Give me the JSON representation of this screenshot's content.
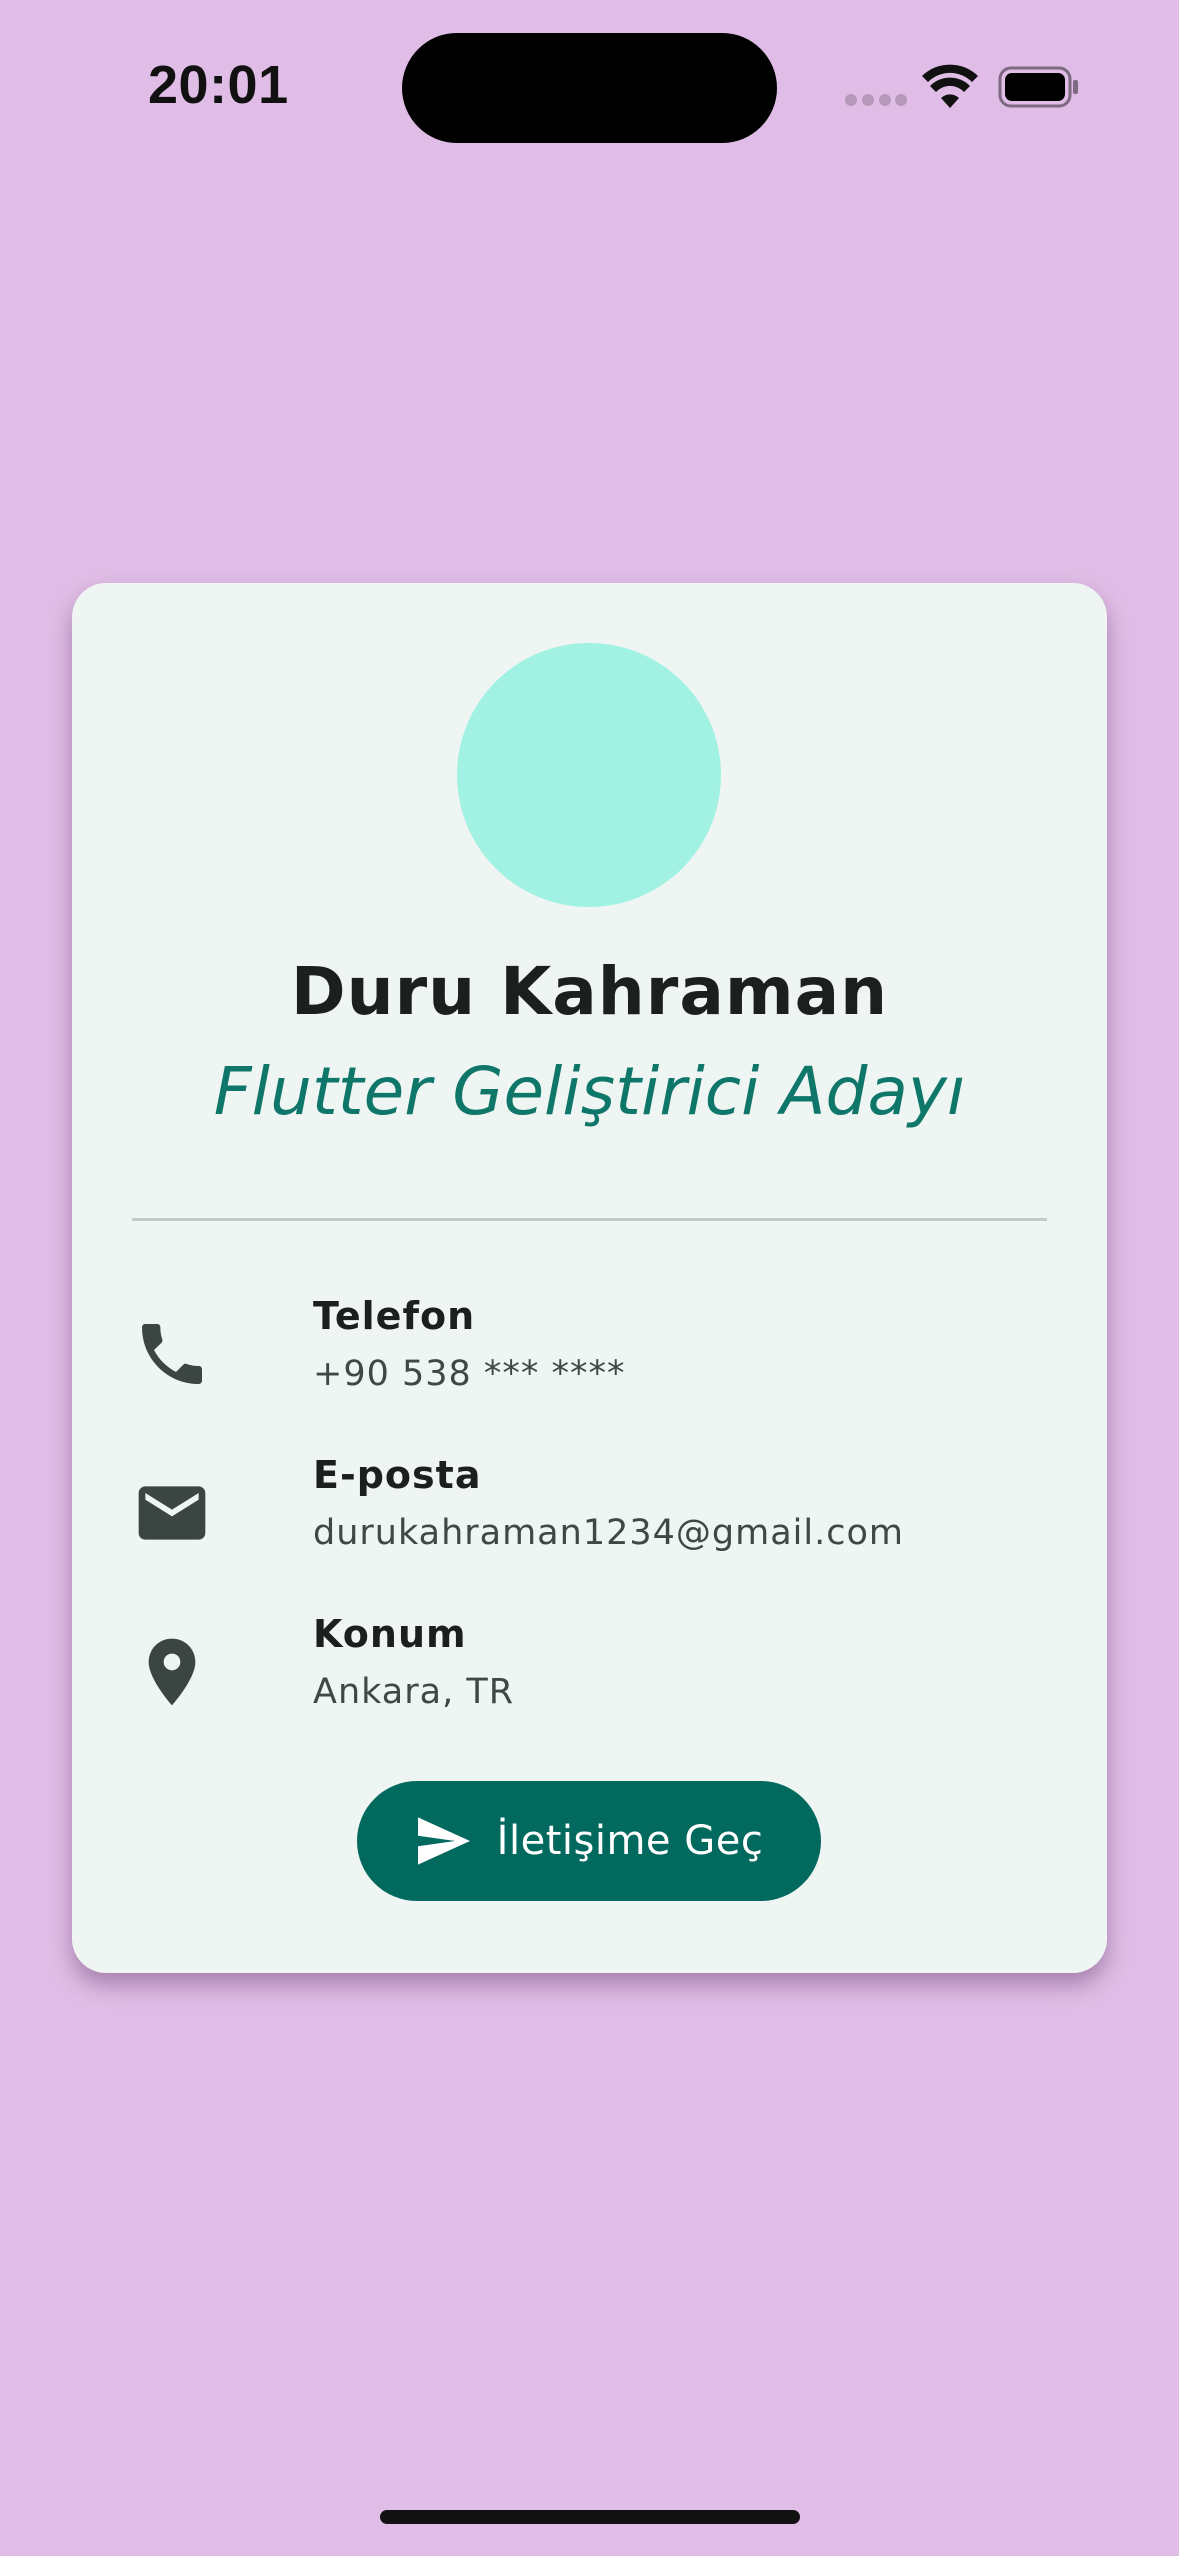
{
  "status_bar": {
    "time": "20:01"
  },
  "profile": {
    "name": "Duru Kahraman",
    "role": "Flutter Geliştirici Adayı",
    "avatar_color": "#a1f2e3"
  },
  "contacts": [
    {
      "icon": "phone-icon",
      "label": "Telefon",
      "value": "+90 538 *** ****"
    },
    {
      "icon": "mail-icon",
      "label": "E-posta",
      "value": "durukahraman1234@gmail.com"
    },
    {
      "icon": "location-pin-icon",
      "label": "Konum",
      "value": "Ankara, TR"
    }
  ],
  "action": {
    "icon": "send-icon",
    "label": "İletişime Geç"
  },
  "colors": {
    "background": "#e0bde6",
    "card": "#eff5f2",
    "accent": "#02695f",
    "role_text": "#0f766a"
  }
}
